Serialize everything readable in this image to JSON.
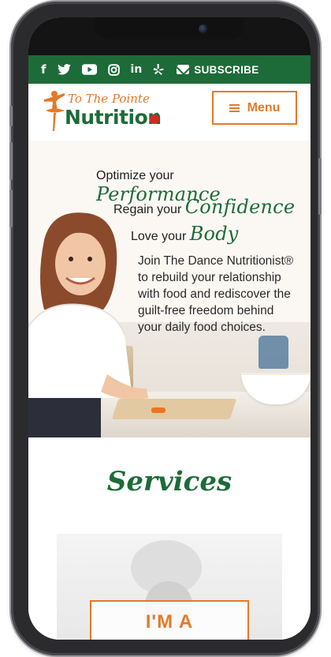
{
  "social_bar": {
    "icons": [
      "facebook-icon",
      "twitter-icon",
      "youtube-icon",
      "instagram-icon",
      "linkedin-icon",
      "yelp-icon",
      "envelope-icon"
    ],
    "subscribe_label": "SUBSCRIBE",
    "bg_color": "#1d6b38"
  },
  "header": {
    "logo_script": "To The Pointe",
    "logo_word": "Nutrition",
    "menu_label": "Menu",
    "accent_color": "#e27a2a"
  },
  "hero": {
    "lines": [
      {
        "lead": "Optimize your",
        "accent": "Performance"
      },
      {
        "lead": "Regain your",
        "accent": "Confidence"
      },
      {
        "lead": "Love your",
        "accent": "Body"
      }
    ],
    "body": "Join The Dance Nutritionist® to rebuild your relationship with food and rediscover the guilt-free freedom behind your daily food choices."
  },
  "services": {
    "title": "Services",
    "card_button_label": "I'M A"
  }
}
